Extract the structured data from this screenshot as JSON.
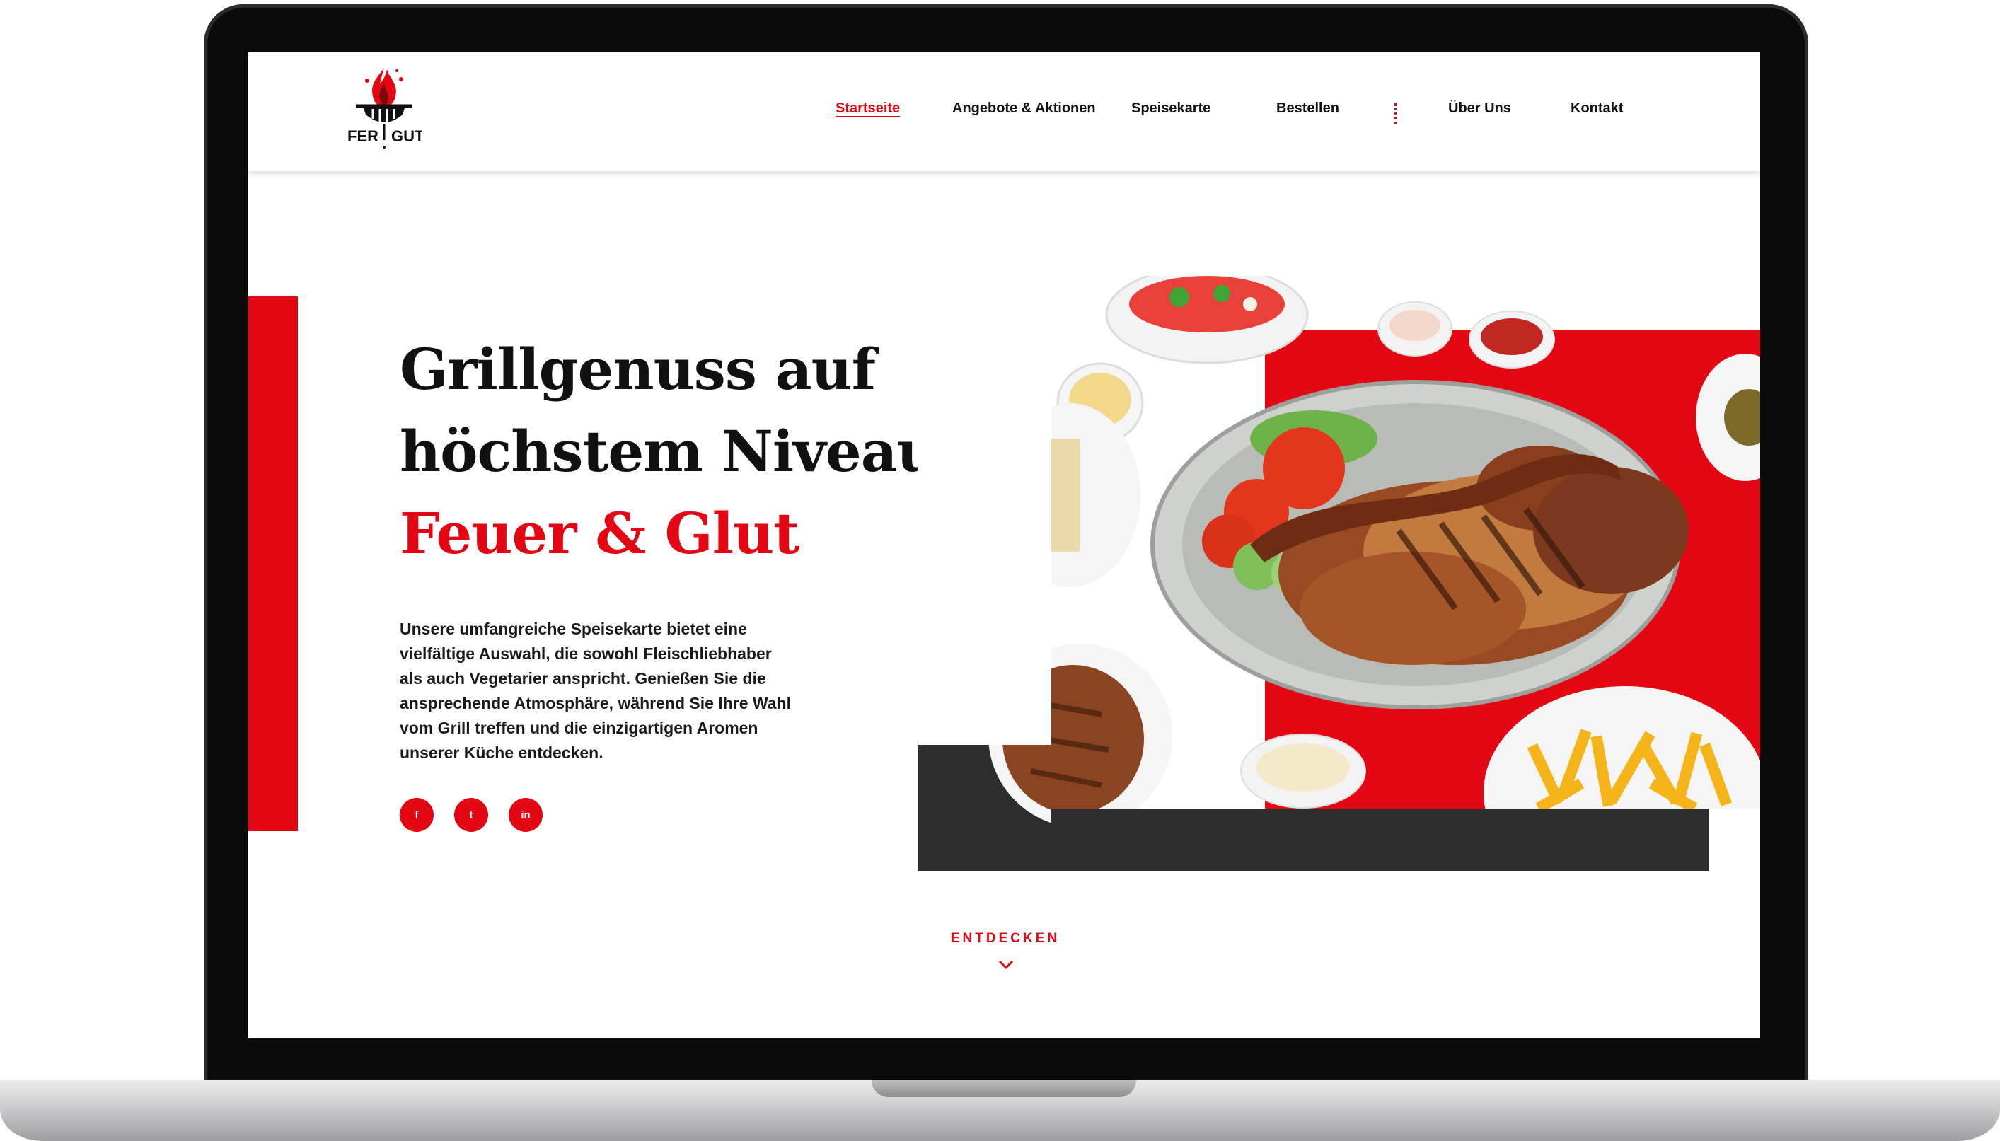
{
  "nav": {
    "logo_text_left": "FER",
    "logo_text_right": "GUT",
    "items": [
      {
        "label": "Startseite",
        "active": true
      },
      {
        "label": "Angebote & Aktionen",
        "active": false
      },
      {
        "label": "Speisekarte",
        "active": false
      },
      {
        "label": "Bestellen",
        "active": false
      },
      {
        "label": "Über Uns",
        "active": false
      },
      {
        "label": "Kontakt",
        "active": false
      }
    ]
  },
  "hero": {
    "headline_line1": "Grillgenuss auf",
    "headline_line2": "höchstem Niveau:",
    "headline_accent": "Feuer & Glut",
    "description": "Unsere umfangreiche Speisekarte bietet eine vielfältige Auswahl, die sowohl Fleischliebhaber als auch Vegetarier anspricht. Genießen Sie die ansprechende Atmosphäre, während Sie Ihre Wahl vom Grill treffen und die einzigartigen Aromen unserer Küche entdecken.",
    "social": [
      {
        "icon": "facebook-icon",
        "glyph": "f"
      },
      {
        "icon": "twitter-icon",
        "glyph": "t"
      },
      {
        "icon": "linkedin-icon",
        "glyph": "in"
      }
    ]
  },
  "discover": {
    "label": "ENTDECKEN",
    "icon": "chevron-down-icon"
  },
  "colors": {
    "accent": "#e30613",
    "dark_block": "#2d2d2d",
    "text": "#111111"
  }
}
